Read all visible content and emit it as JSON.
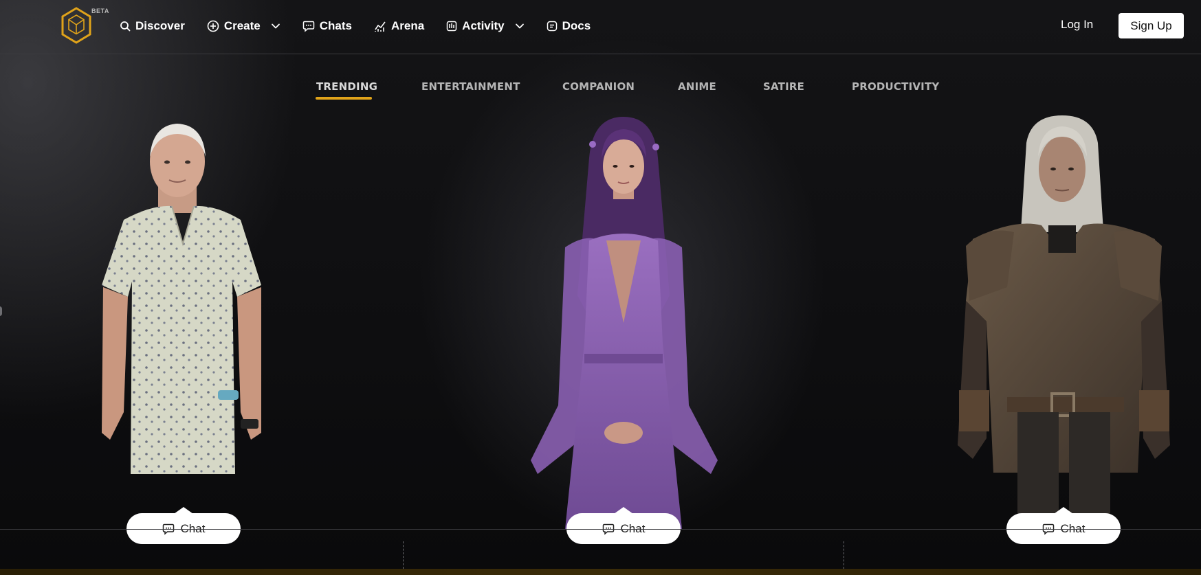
{
  "header": {
    "beta_label": "BETA",
    "nav": [
      {
        "label": "Discover",
        "icon": "search-icon"
      },
      {
        "label": "Create",
        "icon": "plus-circle-icon",
        "dropdown": true
      },
      {
        "label": "Chats",
        "icon": "chat-bubble-icon"
      },
      {
        "label": "Arena",
        "icon": "trending-chart-icon"
      },
      {
        "label": "Activity",
        "icon": "bar-chart-icon",
        "dropdown": true
      },
      {
        "label": "Docs",
        "icon": "document-icon"
      }
    ],
    "login_label": "Log In",
    "signup_label": "Sign Up"
  },
  "tabs": [
    {
      "label": "TRENDING",
      "active": true
    },
    {
      "label": "ENTERTAINMENT",
      "active": false
    },
    {
      "label": "COMPANION",
      "active": false
    },
    {
      "label": "ANIME",
      "active": false
    },
    {
      "label": "SATIRE",
      "active": false
    },
    {
      "label": "PRODUCTIVITY",
      "active": false
    }
  ],
  "characters": [
    {
      "chat_label": "Chat",
      "outfit": "hospital-gown"
    },
    {
      "chat_label": "Chat",
      "outfit": "purple-robe"
    },
    {
      "chat_label": "Chat",
      "outfit": "leather-armor"
    }
  ],
  "colors": {
    "accent": "#e0a31a",
    "background": "#0b0b0d",
    "button_bg": "#ffffff"
  }
}
